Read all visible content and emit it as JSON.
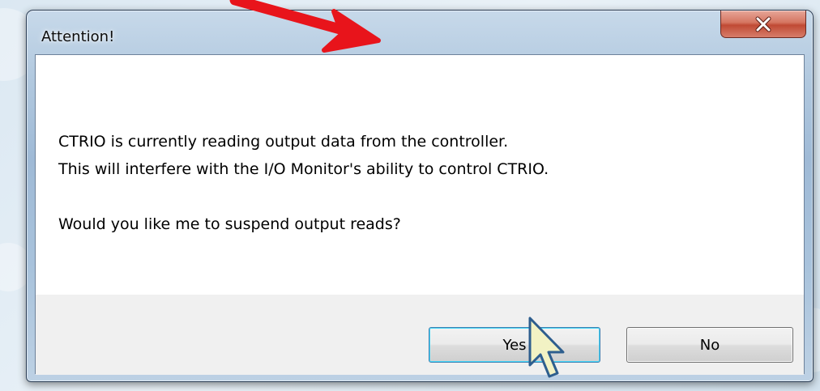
{
  "dialog": {
    "title": "Attention!",
    "close_glyph": "x",
    "message_line1": "CTRIO is currently reading output data from the controller.",
    "message_line2": "This will interfere with the I/O Monitor's ability to control CTRIO.",
    "question": "Would you like me to suspend output reads?",
    "yes_label": "Yes",
    "no_label": "No"
  },
  "colors": {
    "annotation_arrow": "#e8141b",
    "titlebar_glass": "#a9c3dc",
    "close_button": "#c9503b",
    "default_button_focus": "#48d8f8"
  },
  "icons": {
    "close": "close-icon",
    "pointer": "mouse-cursor-icon",
    "annotation": "red-arrow-annotation"
  }
}
